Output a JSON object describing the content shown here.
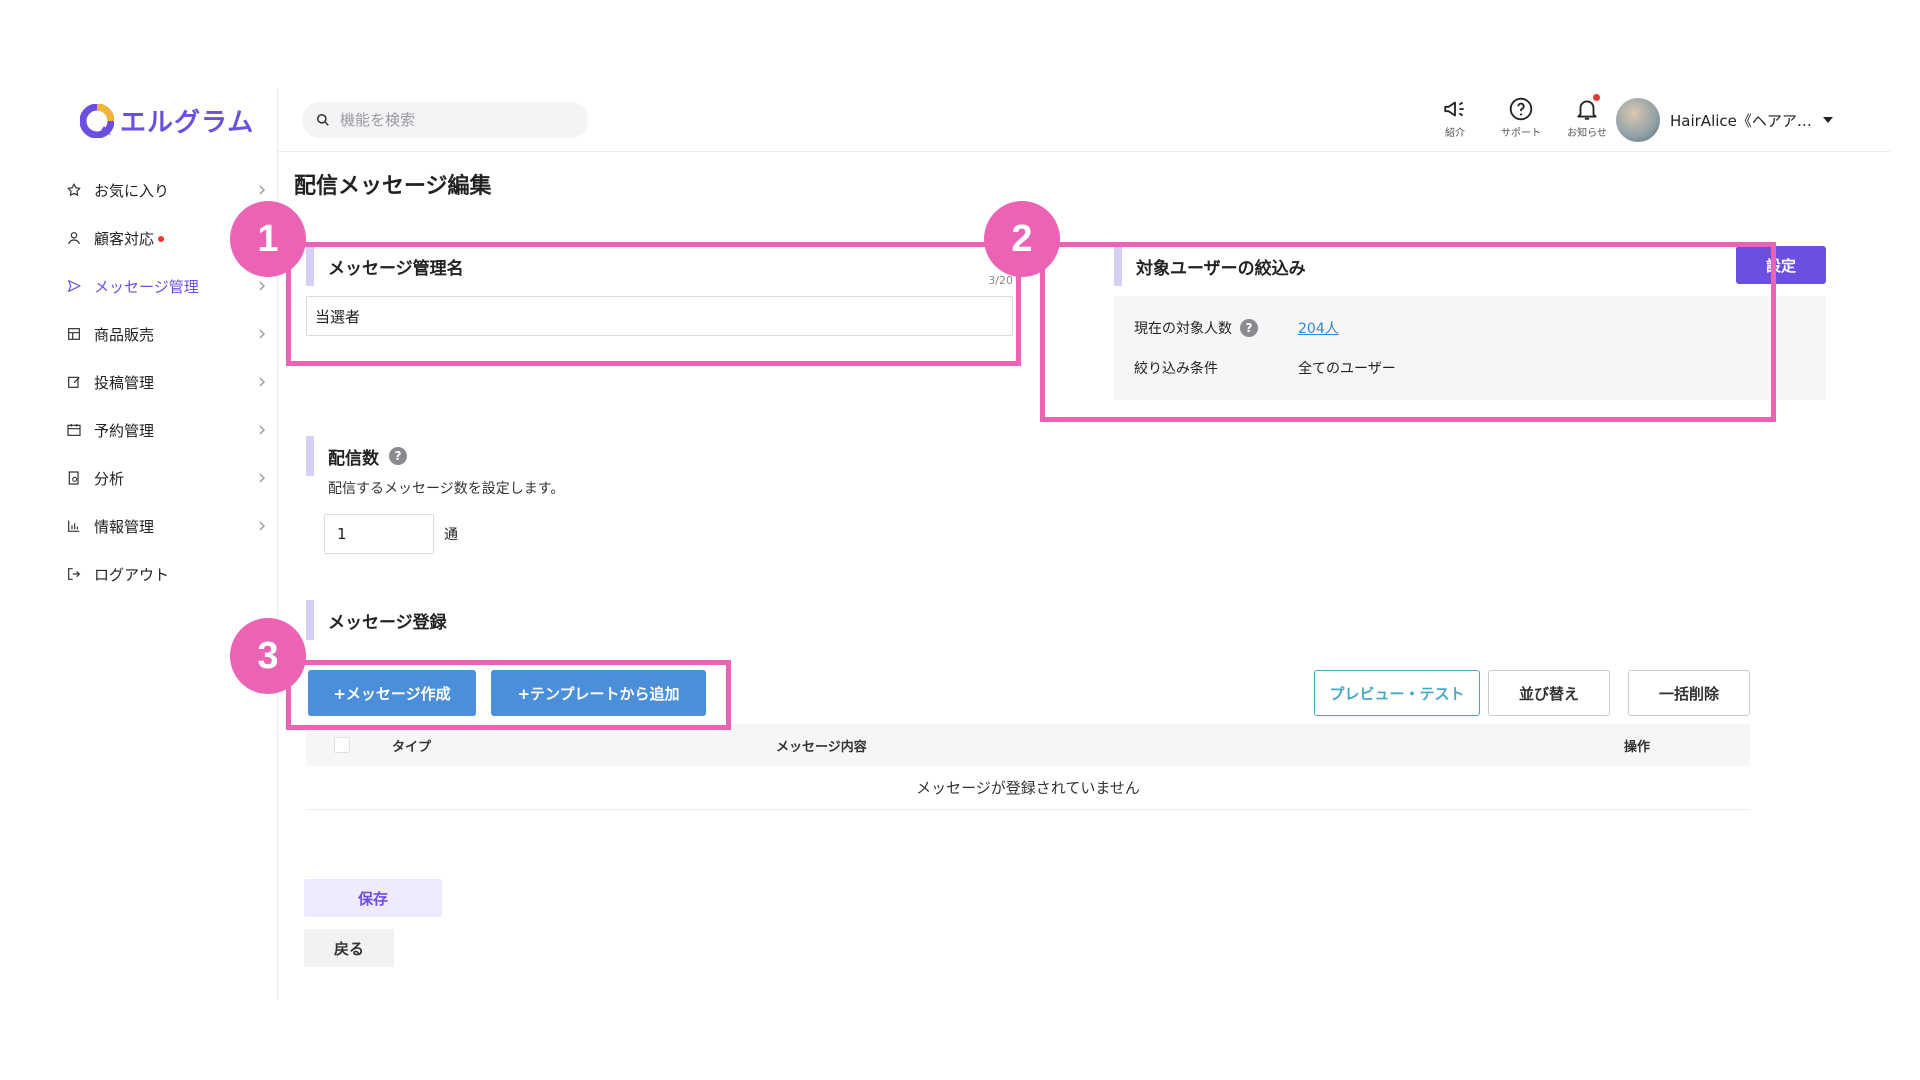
{
  "logo": {
    "text": "エルグラム"
  },
  "sidebar": {
    "items": [
      {
        "label": "お気に入り",
        "icon": "star-icon",
        "dot": false,
        "active": false
      },
      {
        "label": "顧客対応",
        "icon": "user-icon",
        "dot": true,
        "active": false
      },
      {
        "label": "メッセージ管理",
        "icon": "send-icon",
        "dot": false,
        "active": true
      },
      {
        "label": "商品販売",
        "icon": "store-icon",
        "dot": false,
        "active": false
      },
      {
        "label": "投稿管理",
        "icon": "edit-icon",
        "dot": false,
        "active": false
      },
      {
        "label": "予約管理",
        "icon": "calendar-icon",
        "dot": false,
        "active": false
      },
      {
        "label": "分析",
        "icon": "report-icon",
        "dot": false,
        "active": false
      },
      {
        "label": "情報管理",
        "icon": "bar-chart-icon",
        "dot": false,
        "active": false
      },
      {
        "label": "ログアウト",
        "icon": "logout-icon",
        "dot": false,
        "active": false
      }
    ]
  },
  "header": {
    "search_placeholder": "機能を検索",
    "icons": [
      {
        "caption": "紹介",
        "icon": "megaphone-icon"
      },
      {
        "caption": "サポート",
        "icon": "help-circle-icon"
      },
      {
        "caption": "お知らせ",
        "icon": "bell-icon"
      }
    ],
    "user_name": "HairAlice《ヘアア…"
  },
  "page": {
    "title": "配信メッセージ編集",
    "name_section": {
      "title": "メッセージ管理名",
      "count": "3/20",
      "value": "当選者"
    },
    "target_section": {
      "title": "対象ユーザーの絞込み",
      "set_label": "設定",
      "current_label": "現在の対象人数",
      "current_value": "204人",
      "filter_label": "絞り込み条件",
      "filter_value": "全てのユーザー"
    },
    "count_section": {
      "title": "配信数",
      "description": "配信するメッセージ数を設定します。",
      "value": "1",
      "unit": "通"
    },
    "register_section": {
      "title": "メッセージ登録",
      "create_label": "+メッセージ作成",
      "template_label": "+テンプレートから追加",
      "preview_label": "プレビュー・テスト",
      "sort_label": "並び替え",
      "delete_label": "一括削除",
      "col_type": "タイプ",
      "col_content": "メッセージ内容",
      "col_ops": "操作",
      "empty_text": "メッセージが登録されていません"
    },
    "save_label": "保存",
    "back_label": "戻る"
  },
  "annotations": [
    "1",
    "2",
    "3"
  ],
  "colors": {
    "accent": "#6b4fe0",
    "highlight": "#ec63b6",
    "blue_button": "#4b8fdb",
    "link": "#2f86d6",
    "alert": "#e53935"
  }
}
